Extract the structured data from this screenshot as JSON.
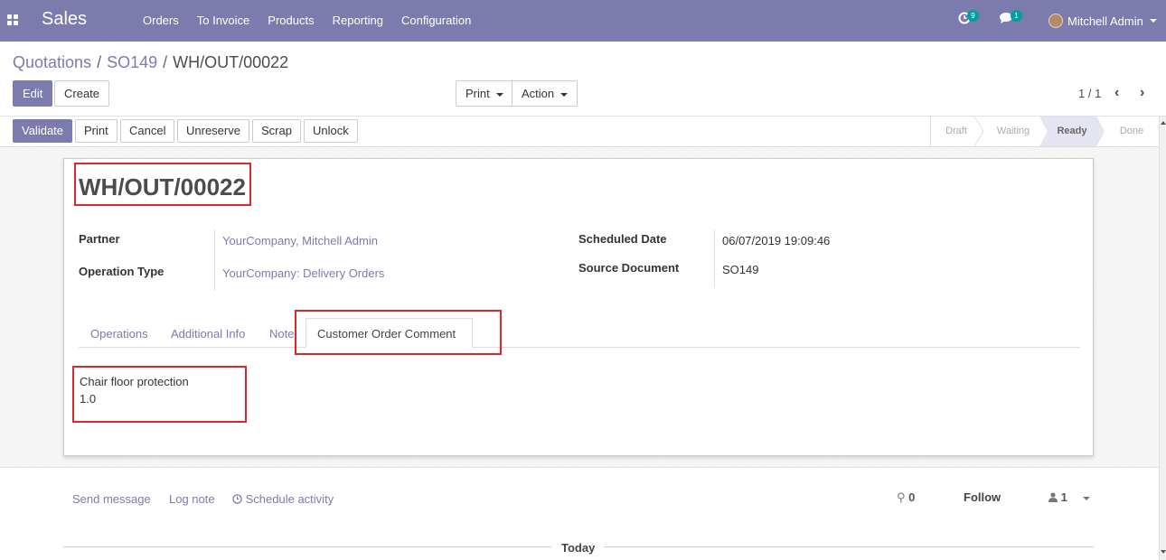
{
  "navbar": {
    "brand": "Sales",
    "menu": [
      "Orders",
      "To Invoice",
      "Products",
      "Reporting",
      "Configuration"
    ],
    "activity_count": "9",
    "message_count": "1",
    "user_name": "Mitchell Admin",
    "color": "#7c7bad"
  },
  "breadcrumb": {
    "first": "Quotations",
    "second": "SO149",
    "current": "WH/OUT/00022"
  },
  "control": {
    "edit": "Edit",
    "create": "Create",
    "print": "Print",
    "action": "Action",
    "pager": "1 / 1"
  },
  "statusbar": {
    "buttons": [
      "Validate",
      "Print",
      "Cancel",
      "Unreserve",
      "Scrap",
      "Unlock"
    ],
    "stages": [
      "Draft",
      "Waiting",
      "Ready",
      "Done"
    ],
    "active_stage": "Ready"
  },
  "record": {
    "name": "WH/OUT/00022",
    "partner_label": "Partner",
    "partner": "YourCompany, Mitchell Admin",
    "operation_type_label": "Operation Type",
    "operation_type": "YourCompany: Delivery Orders",
    "scheduled_date_label": "Scheduled Date",
    "scheduled_date": "06/07/2019 19:09:46",
    "source_document_label": "Source Document",
    "source_document": "SO149"
  },
  "tabs": [
    "Operations",
    "Additional Info",
    "Note",
    "Customer Order Comment"
  ],
  "active_tab": "Customer Order Comment",
  "comment": {
    "line1": "Chair floor protection",
    "line2": "1.0"
  },
  "chatter": {
    "send_message": "Send message",
    "log_note": "Log note",
    "schedule_activity": "Schedule activity",
    "attachments": "0",
    "follow": "Follow",
    "followers": "1",
    "today": "Today"
  }
}
